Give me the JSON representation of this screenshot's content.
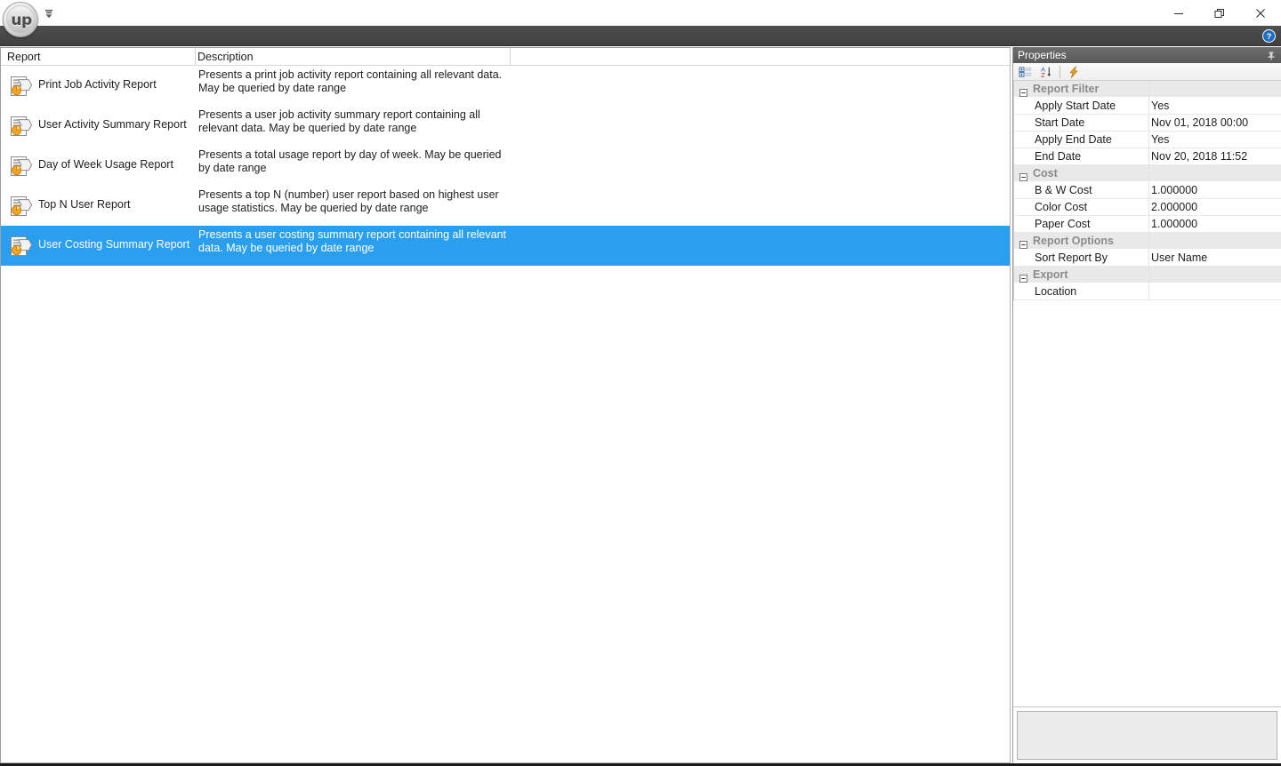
{
  "window": {
    "logo_text": "up",
    "quick_access_icon": "quick-access-dropdown-icon",
    "minimize_label": "—",
    "restore_label": "❑",
    "close_label": "✕",
    "help_icon": "help-icon"
  },
  "list": {
    "columns": [
      "Report",
      "Description"
    ],
    "rows": [
      {
        "icon": "report-document-icon",
        "name": "Print Job Activity Report",
        "description": "Presents a print job activity report containing all relevant data.  May be queried by date range",
        "selected": false
      },
      {
        "icon": "report-document-icon",
        "name": "User Activity Summary Report",
        "description": "Presents a user job activity summary report containing all relevant data.  May be queried by date range",
        "selected": false
      },
      {
        "icon": "report-document-icon",
        "name": "Day of Week Usage Report",
        "description": "Presents a total usage report by day of week.  May be queried by date range",
        "selected": false
      },
      {
        "icon": "report-document-icon",
        "name": "Top N User Report",
        "description": "Presents a top N (number) user report based on highest user usage statistics.  May be queried by date range",
        "selected": false
      },
      {
        "icon": "report-document-icon",
        "name": "User Costing Summary Report",
        "description": "Presents a user costing summary report containing all relevant data.  May be queried by date range",
        "selected": true
      }
    ]
  },
  "properties": {
    "title": "Properties",
    "pin_icon": "pushpin-icon",
    "toolbar": [
      {
        "icon": "categorized-view-icon"
      },
      {
        "icon": "alphabetical-sort-icon"
      },
      {
        "icon": "events-lightning-icon"
      }
    ],
    "groups": [
      {
        "label": "Report Filter",
        "items": [
          {
            "name": "Apply Start Date",
            "value": "Yes"
          },
          {
            "name": "Start Date",
            "value": "Nov 01, 2018 00:00"
          },
          {
            "name": "Apply End Date",
            "value": "Yes"
          },
          {
            "name": "End Date",
            "value": "Nov 20, 2018 11:52"
          }
        ]
      },
      {
        "label": "Cost",
        "items": [
          {
            "name": "B & W Cost",
            "value": "1.000000"
          },
          {
            "name": "Color Cost",
            "value": "2.000000"
          },
          {
            "name": "Paper Cost",
            "value": "1.000000"
          }
        ]
      },
      {
        "label": "Report Options",
        "items": [
          {
            "name": "Sort Report By",
            "value": "User Name"
          }
        ]
      },
      {
        "label": "Export",
        "items": [
          {
            "name": "Location",
            "value": ""
          }
        ]
      }
    ],
    "description_box": ""
  },
  "colors": {
    "selection_blue": "#2a9ff0",
    "ribbon_gray": "#474747",
    "panel_title_gray": "#636363",
    "category_gray": "#e9e9e9",
    "accent_orange": "#f0a020"
  }
}
